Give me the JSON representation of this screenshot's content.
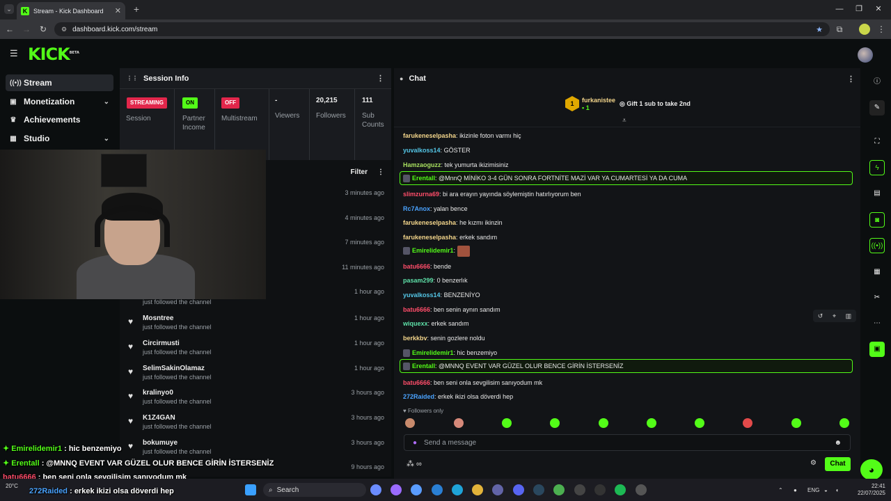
{
  "browser": {
    "tab_title": "Stream - Kick Dashboard",
    "url": "dashboard.kick.com/stream"
  },
  "header": {
    "logo": "KICK",
    "logo_tag": "BETA"
  },
  "nav": {
    "items": [
      {
        "label": "Stream",
        "icon": "broadcast-icon"
      },
      {
        "label": "Monetization",
        "icon": "wallet-icon"
      },
      {
        "label": "Achievements",
        "icon": "trophy-icon"
      },
      {
        "label": "Studio",
        "icon": "studio-icon"
      }
    ]
  },
  "session": {
    "title": "Session Info",
    "streaming_badge": "STREAMING",
    "session_label": "Session",
    "partner_badge": "ON",
    "partner_label": "Partner Income",
    "multistream_badge": "OFF",
    "multistream_label": "Multistream",
    "viewers_value": "-",
    "viewers_label": "Viewers",
    "followers_value": "20,215",
    "followers_label": "Followers",
    "subs_value": "111",
    "subs_label": "Sub Counts"
  },
  "feed": {
    "filter_label": "Filter",
    "hidden_times": [
      "3 minutes ago",
      "4 minutes ago",
      "7 minutes ago",
      "11 minutes ago",
      "1 hour ago"
    ],
    "partial_sub": "just followed the channel",
    "rows": [
      {
        "name": "Mosntree",
        "sub": "just followed the channel",
        "time": "1 hour ago"
      },
      {
        "name": "Circirmusti",
        "sub": "just followed the channel",
        "time": "1 hour ago"
      },
      {
        "name": "SelimSakinOlamaz",
        "sub": "just followed the channel",
        "time": "1 hour ago"
      },
      {
        "name": "kralinyo0",
        "sub": "just followed the channel",
        "time": "3 hours ago"
      },
      {
        "name": "K1Z4GAN",
        "sub": "just followed the channel",
        "time": "3 hours ago"
      },
      {
        "name": "bokumuye",
        "sub": "just followed the channel",
        "time": "3 hours ago"
      },
      {
        "name": "",
        "sub": "",
        "time": "9 hours ago"
      }
    ]
  },
  "overlay_chat": [
    {
      "user": "Emirelidemir1",
      "text": "hic benzemiyo",
      "color": "#53fc18"
    },
    {
      "user": "Erentall",
      "text": "@MNNQ EVENT VAR GÜZEL OLUR BENCE GİRİN İSTERSENİZ",
      "color": "#53fc18"
    },
    {
      "user": "batu6666",
      "text": "ben seni onla sevgilisim sanıyodum mk",
      "color": "#ff4d6a"
    },
    {
      "user": "272Raided",
      "text": "erkek ikizi olsa döverdi hep",
      "color": "#4aa3ff"
    }
  ],
  "chat": {
    "title": "Chat",
    "pinned_user": "furkanistee",
    "pinned_count": "1",
    "pinned_goal": "Gift 1 sub to take 2nd",
    "messages": [
      {
        "user": "farukeneselpasha",
        "color": "#f3d58b",
        "text": "ikizinle foton varmı hiç"
      },
      {
        "user": "yuvalkoss14",
        "color": "#54c6e6",
        "text": "GÖSTER"
      },
      {
        "user": "Hamzaoguzz",
        "color": "#a8e05f",
        "text": "tek yumurta ikizimisiniz"
      },
      {
        "user": "Erentall",
        "color": "#53fc18",
        "text": "@MnnQ MİNİKO 3-4 GÜN SONRA FORTNİTE MAZİ VAR YA CUMARTESİ YA DA CUMA",
        "highlight": true
      },
      {
        "user": "slimzurna69",
        "color": "#ff4d6a",
        "text": "bi ara erayın yayında söylemiştin hatırlıyorum ben"
      },
      {
        "user": "Rc7Anox",
        "color": "#4aa3ff",
        "text": "yalan bence"
      },
      {
        "user": "farukeneselpasha",
        "color": "#f3d58b",
        "text": "he kızmı ikinzin"
      },
      {
        "user": "farukeneselpasha",
        "color": "#f3d58b",
        "text": "erkek sandım"
      },
      {
        "user": "Emirelidemir1",
        "color": "#53fc18",
        "text": ""
      },
      {
        "user": "batu6666",
        "color": "#ff4d6a",
        "text": "bende"
      },
      {
        "user": "pasam299",
        "color": "#5ee0a8",
        "text": "0 benzerlık"
      },
      {
        "user": "yuvalkoss14",
        "color": "#54c6e6",
        "text": "BENZENİYO"
      },
      {
        "user": "batu6666",
        "color": "#ff4d6a",
        "text": "ben senin aynın sandım"
      },
      {
        "user": "wiquexx",
        "color": "#5ee0a8",
        "text": "erkek sandım"
      },
      {
        "user": "berkkbv",
        "color": "#f3d58b",
        "text": "senin gozlere noldu"
      },
      {
        "user": "Emirelidemir1",
        "color": "#53fc18",
        "text": "hic benzemiyo"
      },
      {
        "user": "Erentall",
        "color": "#53fc18",
        "text": "@MNNQ EVENT VAR GÜZEL OLUR BENCE GİRİN İSTERSENİZ",
        "highlight": true
      },
      {
        "user": "batu6666",
        "color": "#ff4d6a",
        "text": "ben seni onla sevgilisim sanıyodum mk"
      },
      {
        "user": "272Raided",
        "color": "#4aa3ff",
        "text": "erkek ikizi olsa döverdi hep"
      }
    ],
    "followers_only": "Followers only",
    "placeholder": "Send a message",
    "send_label": "Chat"
  },
  "taskbar": {
    "search_label": "Search",
    "weather": "20°C",
    "lang": "ENG",
    "time": "22:41",
    "date": "22/07/2025"
  }
}
